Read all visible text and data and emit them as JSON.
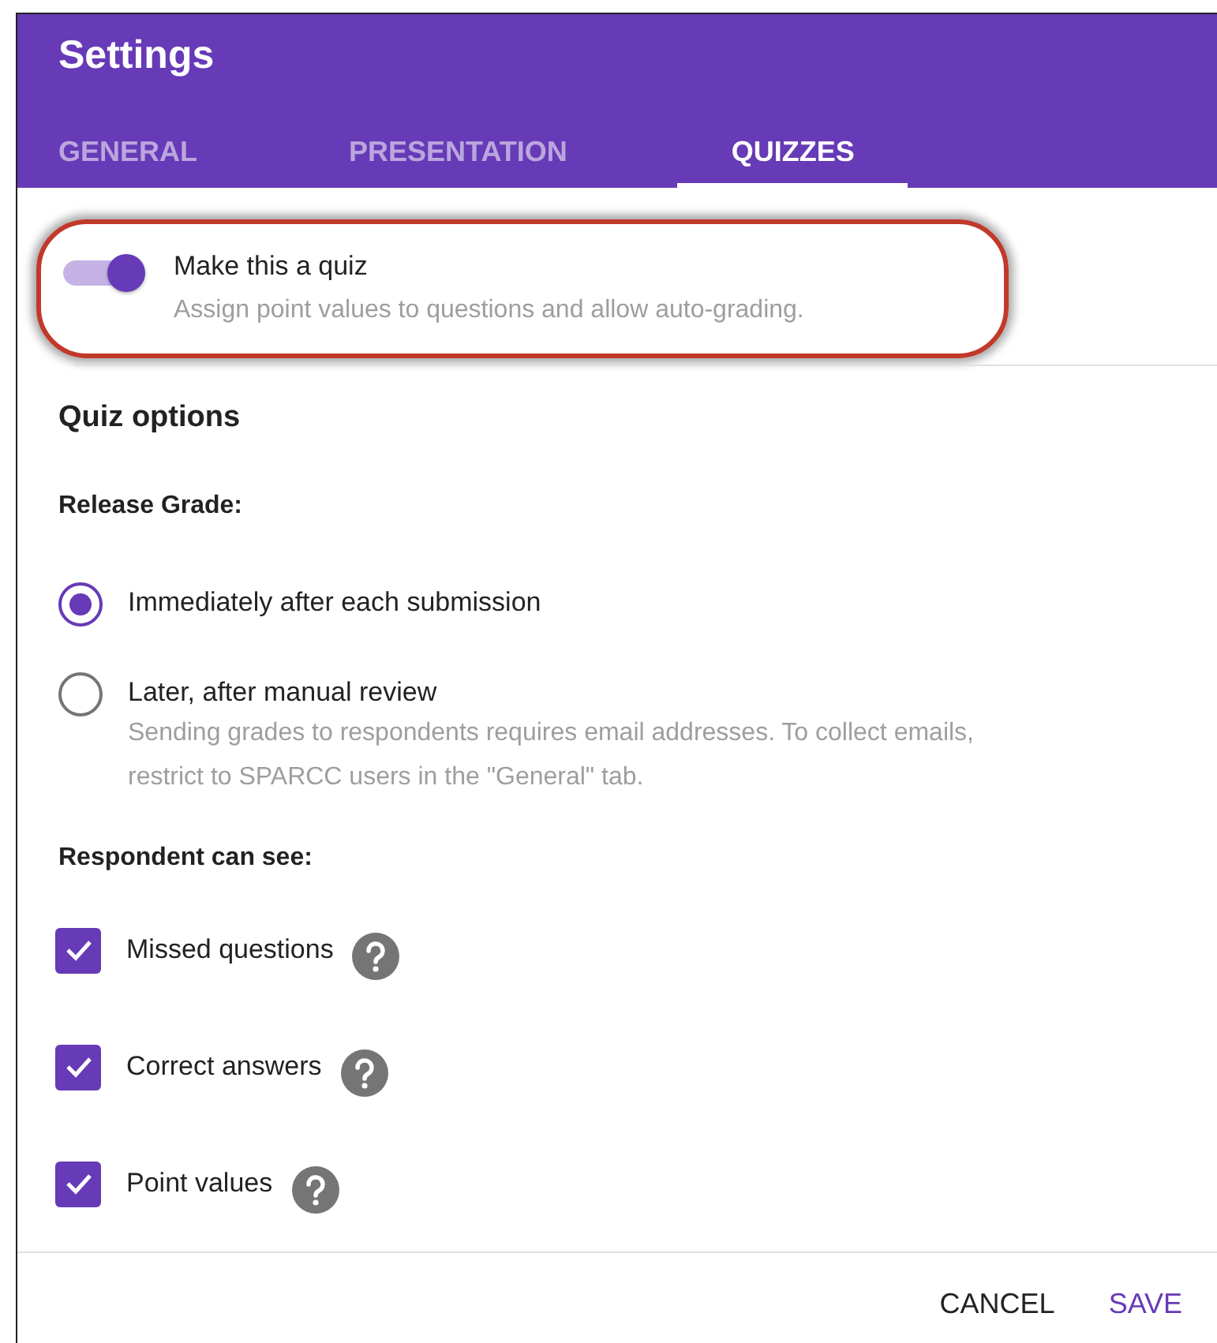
{
  "dialog": {
    "title": "Settings"
  },
  "tabs": [
    {
      "label": "GENERAL",
      "selected": false
    },
    {
      "label": "PRESENTATION",
      "selected": false
    },
    {
      "label": "QUIZZES",
      "selected": true
    }
  ],
  "quiz_toggle": {
    "label": "Make this a quiz",
    "description": "Assign point values to questions and allow auto-grading.",
    "on": true,
    "highlighted": true
  },
  "quiz_options": {
    "heading": "Quiz options",
    "release_grade": {
      "label": "Release Grade:",
      "options": [
        {
          "label": "Immediately after each submission",
          "selected": true
        },
        {
          "label": "Later, after manual review",
          "selected": false,
          "note": "Sending grades to respondents requires email addresses. To collect emails, restrict to SPARCC users in the \"General\" tab."
        }
      ]
    },
    "respondent_can_see": {
      "label": "Respondent can see:",
      "items": [
        {
          "label": "Missed questions",
          "checked": true
        },
        {
          "label": "Correct answers",
          "checked": true
        },
        {
          "label": "Point values",
          "checked": true
        }
      ]
    }
  },
  "buttons": [
    {
      "label": "CANCEL",
      "kind": "secondary"
    },
    {
      "label": "SAVE",
      "kind": "primary"
    }
  ]
}
